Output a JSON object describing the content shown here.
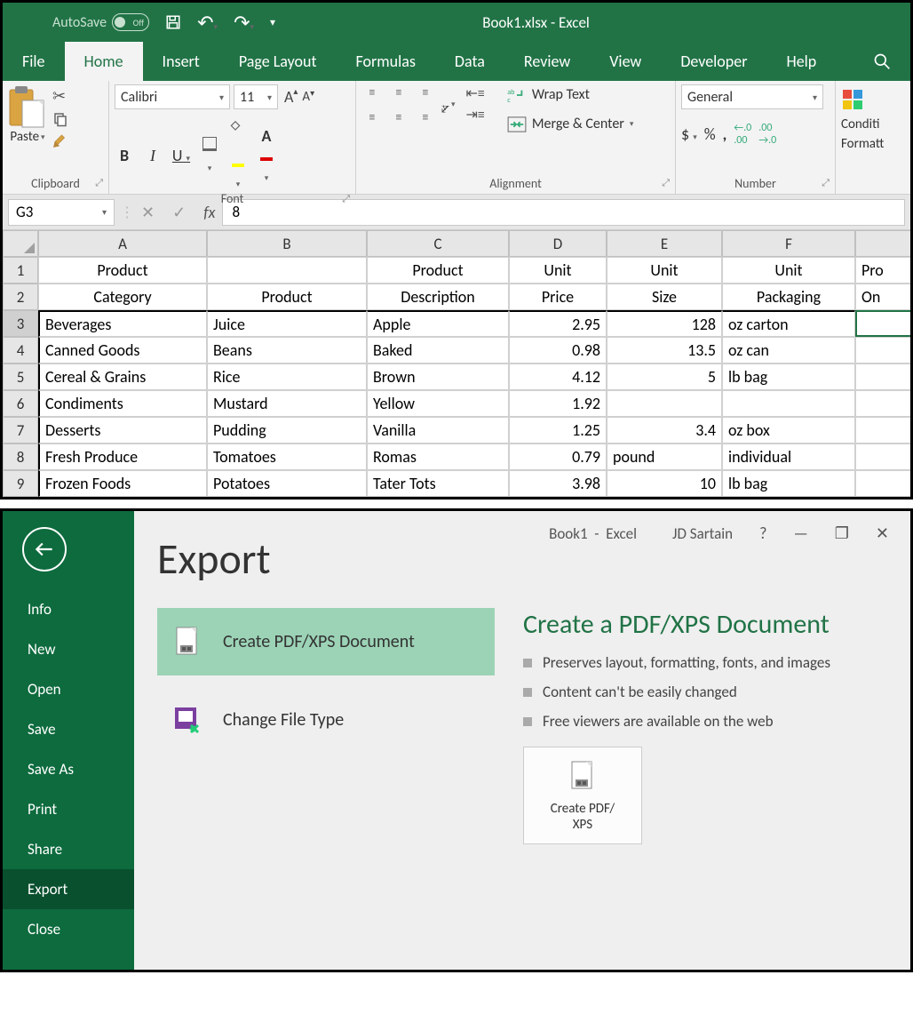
{
  "titlebar": {
    "autosave_label": "AutoSave",
    "autosave_state": "Off",
    "title": "Book1.xlsx  -  Excel"
  },
  "tabs": [
    "File",
    "Home",
    "Insert",
    "Page Layout",
    "Formulas",
    "Data",
    "Review",
    "View",
    "Developer",
    "Help"
  ],
  "active_tab": "Home",
  "ribbon": {
    "clipboard": {
      "label": "Clipboard",
      "paste": "Paste"
    },
    "font": {
      "label": "Font",
      "name": "Calibri",
      "size": "11",
      "bold": "B",
      "italic": "I",
      "underline": "U"
    },
    "alignment": {
      "label": "Alignment",
      "wrap": "Wrap Text",
      "merge": "Merge & Center"
    },
    "number": {
      "label": "Number",
      "format": "General"
    },
    "cond": {
      "label1": "Conditi",
      "label2": "Formatt"
    }
  },
  "formula_bar": {
    "name_box": "G3",
    "value": "8"
  },
  "grid": {
    "cols": [
      "A",
      "B",
      "C",
      "D",
      "E",
      "F",
      ""
    ],
    "header_row1": [
      "Product",
      "",
      "Product",
      "Unit",
      "Unit",
      "Unit",
      "Pro"
    ],
    "header_row2": [
      "Category",
      "Product",
      "Description",
      "Price",
      "Size",
      "Packaging",
      "On "
    ],
    "rows": [
      {
        "n": 3,
        "a": "Beverages",
        "b": "Juice",
        "c": "Apple",
        "d": "2.95",
        "e": "128",
        "f": "oz carton",
        "g": ""
      },
      {
        "n": 4,
        "a": "Canned Goods",
        "b": "Beans",
        "c": "Baked",
        "d": "0.98",
        "e": "13.5",
        "f": "oz can",
        "g": ""
      },
      {
        "n": 5,
        "a": "Cereal & Grains",
        "b": "Rice",
        "c": "Brown",
        "d": "4.12",
        "e": "5",
        "f": "lb bag",
        "g": ""
      },
      {
        "n": 6,
        "a": "Condiments",
        "b": "Mustard",
        "c": "Yellow",
        "d": "1.92",
        "e": "",
        "f": "",
        "g": ""
      },
      {
        "n": 7,
        "a": "Desserts",
        "b": "Pudding",
        "c": "Vanilla",
        "d": "1.25",
        "e": "3.4",
        "f": "oz box",
        "g": ""
      },
      {
        "n": 8,
        "a": "Fresh Produce",
        "b": "Tomatoes",
        "c": "Romas",
        "d": "0.79",
        "e": "pound",
        "f": "individual",
        "g": ""
      },
      {
        "n": 9,
        "a": "Frozen Foods",
        "b": "Potatoes",
        "c": "Tater Tots",
        "d": "3.98",
        "e": "10",
        "f": "lb bag",
        "g": ""
      }
    ]
  },
  "backstage": {
    "window_title_doc": "Book1",
    "window_title_app": "Excel",
    "user": "JD Sartain",
    "menu": [
      "Info",
      "New",
      "Open",
      "Save",
      "Save As",
      "Print",
      "Share",
      "Export",
      "Close"
    ],
    "selected": "Export",
    "heading": "Export",
    "options": [
      {
        "label": "Create PDF/XPS Document",
        "selected": true
      },
      {
        "label": "Change File Type",
        "selected": false
      }
    ],
    "detail_heading": "Create a PDF/XPS Document",
    "bullets": [
      "Preserves layout, formatting, fonts, and images",
      "Content can't be easily changed",
      "Free viewers are available on the web"
    ],
    "button_line1": "Create PDF/",
    "button_line2": "XPS"
  }
}
